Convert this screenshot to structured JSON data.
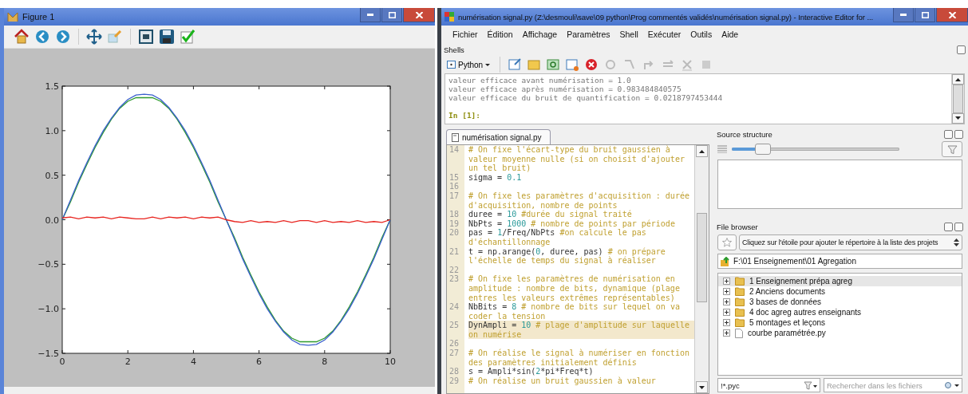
{
  "figure_window": {
    "title": "Figure 1",
    "chart_data": {
      "type": "line",
      "x": [
        0,
        0.25,
        0.5,
        0.75,
        1,
        1.25,
        1.5,
        1.75,
        2,
        2.25,
        2.5,
        2.75,
        3,
        3.25,
        3.5,
        3.75,
        4,
        4.25,
        4.5,
        4.75,
        5,
        5.25,
        5.5,
        5.75,
        6,
        6.25,
        6.5,
        6.75,
        7,
        7.25,
        7.5,
        7.75,
        8,
        8.25,
        8.5,
        8.75,
        9,
        9.25,
        9.5,
        9.75,
        10
      ],
      "series": [
        {
          "color": "#2e9a2e",
          "values": [
            0,
            0.2,
            0.42,
            0.62,
            0.81,
            0.98,
            1.13,
            1.25,
            1.33,
            1.37,
            1.37,
            1.37,
            1.33,
            1.25,
            1.13,
            0.98,
            0.81,
            0.62,
            0.42,
            0.2,
            0,
            -0.2,
            -0.42,
            -0.62,
            -0.81,
            -0.98,
            -1.13,
            -1.25,
            -1.33,
            -1.37,
            -1.37,
            -1.37,
            -1.33,
            -1.25,
            -1.13,
            -0.98,
            -0.81,
            -0.62,
            -0.42,
            -0.2,
            0
          ]
        },
        {
          "color": "#3a5fcd",
          "values": [
            0,
            0.22,
            0.44,
            0.64,
            0.83,
            1.0,
            1.14,
            1.26,
            1.35,
            1.4,
            1.41,
            1.4,
            1.35,
            1.26,
            1.14,
            1.0,
            0.83,
            0.64,
            0.44,
            0.22,
            0,
            -0.22,
            -0.44,
            -0.64,
            -0.83,
            -1.0,
            -1.14,
            -1.26,
            -1.35,
            -1.4,
            -1.41,
            -1.4,
            -1.35,
            -1.26,
            -1.14,
            -1.0,
            -0.83,
            -0.64,
            -0.44,
            -0.22,
            0
          ]
        },
        {
          "color": "#e8231e",
          "values": [
            0.02,
            0.03,
            0.01,
            0.03,
            0.02,
            0.03,
            0.01,
            0.03,
            0.02,
            0.01,
            0.01,
            0.03,
            0.01,
            0.03,
            0.02,
            0.03,
            0.01,
            0.03,
            0.02,
            0.03,
            0,
            -0.02,
            -0.03,
            -0.01,
            -0.03,
            -0.02,
            -0.03,
            -0.01,
            -0.03,
            -0.01,
            -0.01,
            -0.03,
            -0.01,
            -0.03,
            -0.02,
            -0.03,
            -0.01,
            -0.03,
            -0.02,
            -0.03,
            0
          ]
        }
      ],
      "xlim": [
        0,
        10
      ],
      "ylim": [
        -1.5,
        1.5
      ],
      "xticks": [
        0,
        2,
        4,
        6,
        8,
        10
      ],
      "yticks": [
        {
          "value": -1.5,
          "label": "−1.5"
        },
        {
          "value": -1.0,
          "label": "−1.0"
        },
        {
          "value": -0.5,
          "label": "−0.5"
        },
        {
          "value": 0,
          "label": "0.0"
        },
        {
          "value": 0.5,
          "label": "0.5"
        },
        {
          "value": 1.0,
          "label": "1.0"
        },
        {
          "value": 1.5,
          "label": "1.5"
        }
      ]
    }
  },
  "editor_window": {
    "title": "numérisation signal.py (Z:\\desmouli\\save\\09 python\\Prog commentés validés\\numérisation signal.py) - Interactive Editor for ...",
    "menu": [
      "Fichier",
      "Édition",
      "Affichage",
      "Paramètres",
      "Shell",
      "Exécuter",
      "Outils",
      "Aide"
    ],
    "shells": {
      "title": "Shells",
      "interpreter": "Python",
      "output": [
        "valeur efficace avant numérisation = 1.0",
        "valeur efficace après numérisation = 0.983484840575",
        "valeur efficace du bruit de quantification = 0.0218797453444"
      ],
      "prompt": "In [1]:"
    },
    "editor": {
      "tab": "numérisation signal.py",
      "lines": [
        {
          "number": "14",
          "highlighted": false,
          "rows": [
            [
              {
                "kind": "comment",
                "text": "# On fixe l'écart-type du bruit gaussien à"
              }
            ],
            [
              {
                "kind": "comment",
                "text": "valeur moyenne nulle (si on choisit d'ajouter"
              }
            ],
            [
              {
                "kind": "comment",
                "text": "un tel bruit)"
              }
            ]
          ]
        },
        {
          "number": "15",
          "highlighted": false,
          "rows": [
            [
              {
                "kind": "code",
                "text": "sigma = "
              },
              {
                "kind": "number",
                "text": "0.1"
              }
            ]
          ]
        },
        {
          "number": "16",
          "highlighted": false,
          "rows": [
            []
          ]
        },
        {
          "number": "17",
          "highlighted": false,
          "rows": [
            [
              {
                "kind": "comment",
                "text": "# On fixe les paramètres d'acquisition : durée"
              }
            ],
            [
              {
                "kind": "comment",
                "text": "d'acquisition, nombre de points"
              }
            ]
          ]
        },
        {
          "number": "18",
          "highlighted": false,
          "rows": [
            [
              {
                "kind": "code",
                "text": "duree = "
              },
              {
                "kind": "number",
                "text": "10"
              },
              {
                "kind": "comment",
                "text": " #durée du signal traité"
              }
            ]
          ]
        },
        {
          "number": "19",
          "highlighted": false,
          "rows": [
            [
              {
                "kind": "code",
                "text": "NbPts = "
              },
              {
                "kind": "number",
                "text": "1000"
              },
              {
                "kind": "comment",
                "text": " # nombre de points par période"
              }
            ]
          ]
        },
        {
          "number": "20",
          "highlighted": false,
          "rows": [
            [
              {
                "kind": "code",
                "text": "pas = "
              },
              {
                "kind": "number",
                "text": "1"
              },
              {
                "kind": "code",
                "text": "/Freq/NbPts "
              },
              {
                "kind": "comment",
                "text": "#on calcule le pas"
              }
            ],
            [
              {
                "kind": "comment",
                "text": "d'échantillonnage"
              }
            ]
          ]
        },
        {
          "number": "21",
          "highlighted": false,
          "rows": [
            [
              {
                "kind": "code",
                "text": "t = np.arange("
              },
              {
                "kind": "number",
                "text": "0"
              },
              {
                "kind": "code",
                "text": ", duree, pas) "
              },
              {
                "kind": "comment",
                "text": "# on prépare"
              }
            ],
            [
              {
                "kind": "comment",
                "text": "l'échelle de temps du signal à réaliser"
              }
            ]
          ]
        },
        {
          "number": "22",
          "highlighted": false,
          "rows": [
            []
          ]
        },
        {
          "number": "23",
          "highlighted": false,
          "rows": [
            [
              {
                "kind": "comment",
                "text": "# On fixe les paramètres de numérisation en"
              }
            ],
            [
              {
                "kind": "comment",
                "text": "amplitude : nombre de bits, dynamique (plage"
              }
            ],
            [
              {
                "kind": "comment",
                "text": "entres les valeurs extrêmes représentables)"
              }
            ]
          ]
        },
        {
          "number": "24",
          "highlighted": false,
          "rows": [
            [
              {
                "kind": "code",
                "text": "NbBits = "
              },
              {
                "kind": "number",
                "text": "8"
              },
              {
                "kind": "comment",
                "text": " # nombre de bits sur lequel on va"
              }
            ],
            [
              {
                "kind": "comment",
                "text": "coder la tension"
              }
            ]
          ]
        },
        {
          "number": "25",
          "highlighted": true,
          "rows": [
            [
              {
                "kind": "code",
                "text": "DynAmpli = "
              },
              {
                "kind": "number",
                "text": "10"
              },
              {
                "kind": "comment",
                "text": " # plage d'amplitude sur laquelle"
              }
            ],
            [
              {
                "kind": "comment",
                "text": "on numérise"
              }
            ]
          ]
        },
        {
          "number": "26",
          "highlighted": false,
          "rows": [
            []
          ]
        },
        {
          "number": "27",
          "highlighted": false,
          "rows": [
            [
              {
                "kind": "comment",
                "text": "# On réalise le signal à numériser en fonction"
              }
            ],
            [
              {
                "kind": "comment",
                "text": "des paramètres initialement définis"
              }
            ]
          ]
        },
        {
          "number": "28",
          "highlighted": false,
          "rows": [
            [
              {
                "kind": "code",
                "text": "s = Ampli*sin("
              },
              {
                "kind": "number",
                "text": "2"
              },
              {
                "kind": "code",
                "text": "*pi*Freq*t)"
              }
            ]
          ]
        },
        {
          "number": "29",
          "highlighted": false,
          "rows": [
            [
              {
                "kind": "comment",
                "text": "# On réalise un bruit gaussien à valeur"
              }
            ]
          ]
        }
      ]
    },
    "source_structure": {
      "title": "Source structure",
      "level": 0.18
    },
    "file_browser": {
      "title": "File browser",
      "project_combo": "Cliquez sur l'étoile pour ajouter le répertoire à la liste des projets",
      "path": "F:\\01 Enseignement\\01 Agregation",
      "items": [
        {
          "kind": "folder",
          "label": "1 Enseignement prépa agreg",
          "selected": true
        },
        {
          "kind": "folder",
          "label": "2 Anciens documents",
          "selected": false
        },
        {
          "kind": "folder",
          "label": "3 bases de données",
          "selected": false
        },
        {
          "kind": "folder",
          "label": "4 doc agreg autres enseignants",
          "selected": false
        },
        {
          "kind": "folder",
          "label": "5 montages et leçons",
          "selected": false
        },
        {
          "kind": "file",
          "label": "courbe paramétrée.py",
          "selected": false
        }
      ],
      "filter": "!*.pyc",
      "search_placeholder": "Rechercher dans les fichiers"
    }
  }
}
